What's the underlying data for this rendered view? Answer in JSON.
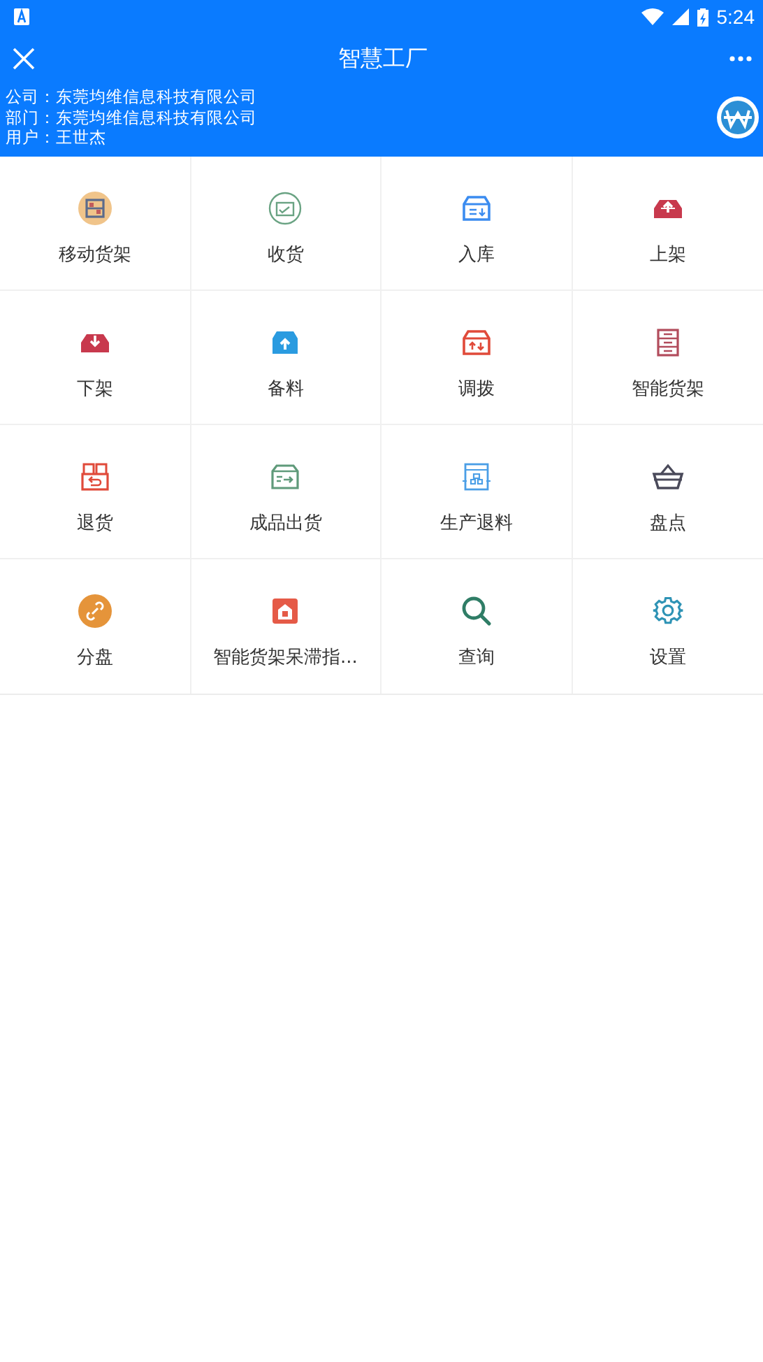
{
  "status_bar": {
    "time": "5:24"
  },
  "toolbar": {
    "title": "智慧工厂"
  },
  "info": [
    {
      "label": "公司：",
      "value": "东莞均维信息科技有限公司"
    },
    {
      "label": "部门：",
      "value": "东莞均维信息科技有限公司"
    },
    {
      "label": "用户：",
      "value": "王世杰"
    }
  ],
  "menu": [
    {
      "label": "移动货架"
    },
    {
      "label": "收货"
    },
    {
      "label": "入库"
    },
    {
      "label": "上架"
    },
    {
      "label": "下架"
    },
    {
      "label": "备料"
    },
    {
      "label": "调拨"
    },
    {
      "label": "智能货架"
    },
    {
      "label": "退货"
    },
    {
      "label": "成品出货"
    },
    {
      "label": "生产退料"
    },
    {
      "label": "盘点"
    },
    {
      "label": "分盘"
    },
    {
      "label": "智能货架呆滞指..."
    },
    {
      "label": "查询"
    },
    {
      "label": "设置"
    }
  ]
}
